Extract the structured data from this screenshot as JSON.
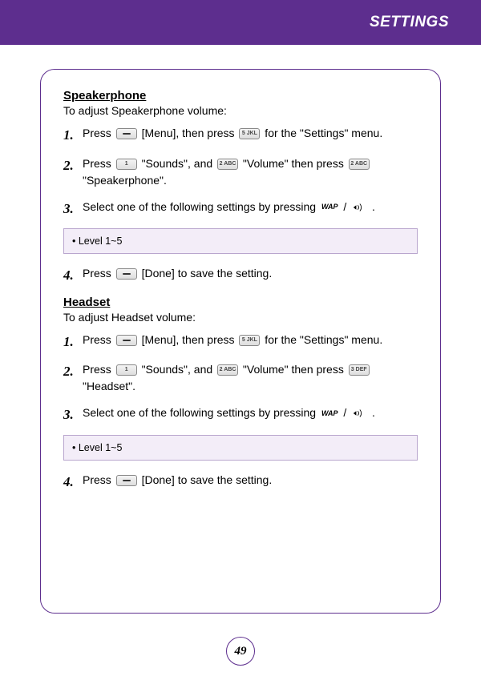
{
  "header": {
    "title": "SETTINGS"
  },
  "speakerphone": {
    "title": "Speakerphone",
    "sub": "To adjust Speakerphone volume:",
    "steps": {
      "s1": {
        "num": "1.",
        "a": "Press ",
        "b": " [Menu], then press ",
        "c": " for the \"Settings\" menu."
      },
      "s2": {
        "num": "2.",
        "a": "Press ",
        "b": " \"Sounds\", and ",
        "c": " \"Volume\" then press ",
        "d": " \"Speakerphone\"."
      },
      "s3": {
        "num": "3.",
        "a": "Select one of the following settings by pressing ",
        "slash": " / ",
        "b": " ."
      },
      "s4": {
        "num": "4.",
        "a": "Press ",
        "b": " [Done] to save the setting."
      }
    },
    "info": "• Level 1~5"
  },
  "headset": {
    "title": "Headset",
    "sub": "To adjust Headset volume:",
    "steps": {
      "s1": {
        "num": "1.",
        "a": "Press ",
        "b": " [Menu], then press ",
        "c": " for the \"Settings\" menu."
      },
      "s2": {
        "num": "2.",
        "a": "Press ",
        "b": " \"Sounds\", and ",
        "c": " \"Volume\" then press ",
        "d": " \"Headset\"."
      },
      "s3": {
        "num": "3.",
        "a": "Select one of the following settings by pressing ",
        "slash": " / ",
        "b": " ."
      },
      "s4": {
        "num": "4.",
        "a": "Press ",
        "b": " [Done] to save the setting."
      }
    },
    "info": "• Level 1~5"
  },
  "keys": {
    "five": "5 JKL",
    "one": "1",
    "two": "2 ABC",
    "three": "3 DEF",
    "wap": "WAP"
  },
  "page": "49"
}
